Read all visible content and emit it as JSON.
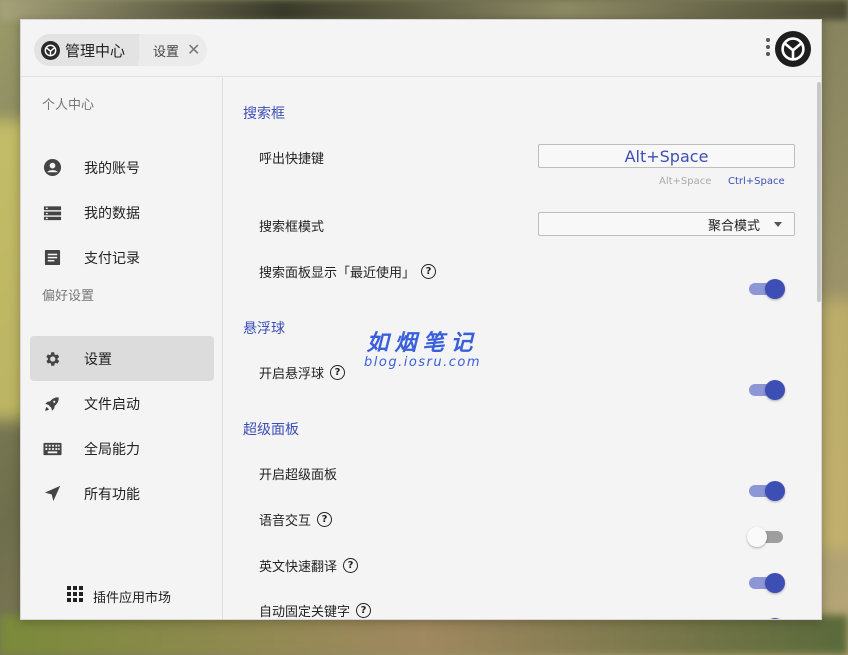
{
  "window": {
    "tab_main_label": "管理中心",
    "tab_settings_label": "设置",
    "tab_close_glyph": "✕"
  },
  "sidebar": {
    "section_personal": "个人中心",
    "section_preferences": "偏好设置",
    "items": [
      {
        "label": "我的账号",
        "icon": "account-circle-icon"
      },
      {
        "label": "我的数据",
        "icon": "storage-icon"
      },
      {
        "label": "支付记录",
        "icon": "receipt-icon"
      },
      {
        "label": "设置",
        "icon": "gear-icon",
        "active": true
      },
      {
        "label": "文件启动",
        "icon": "rocket-icon"
      },
      {
        "label": "全局能力",
        "icon": "keyboard-icon"
      },
      {
        "label": "所有功能",
        "icon": "navigation-arrow-icon"
      }
    ],
    "market_label": "插件应用市场"
  },
  "content": {
    "search_box": {
      "title": "搜索框",
      "hotkey_label": "呼出快捷键",
      "hotkey_value": "Alt+Space",
      "hint_option_1": "Alt+Space",
      "hint_option_2": "Ctrl+Space",
      "mode_label": "搜索框模式",
      "mode_value": "聚合模式",
      "recent_label": "搜索面板显示「最近使用」",
      "recent_on": true
    },
    "floating_ball": {
      "title": "悬浮球",
      "enable_label": "开启悬浮球",
      "enable_on": true
    },
    "super_panel": {
      "title": "超级面板",
      "enable_label": "开启超级面板",
      "enable_on": true,
      "voice_label": "语音交互",
      "voice_on": false,
      "translate_label": "英文快速翻译",
      "translate_on": true,
      "pin_label": "自动固定关键字",
      "pin_on": true
    },
    "help_glyph": "?"
  },
  "watermark": {
    "line1": "如烟笔记",
    "line2": "blog.iosru.com"
  },
  "colors": {
    "accent": "#3d4fb5",
    "accent_track": "#8e97d6",
    "background": "#f4f4f4"
  }
}
